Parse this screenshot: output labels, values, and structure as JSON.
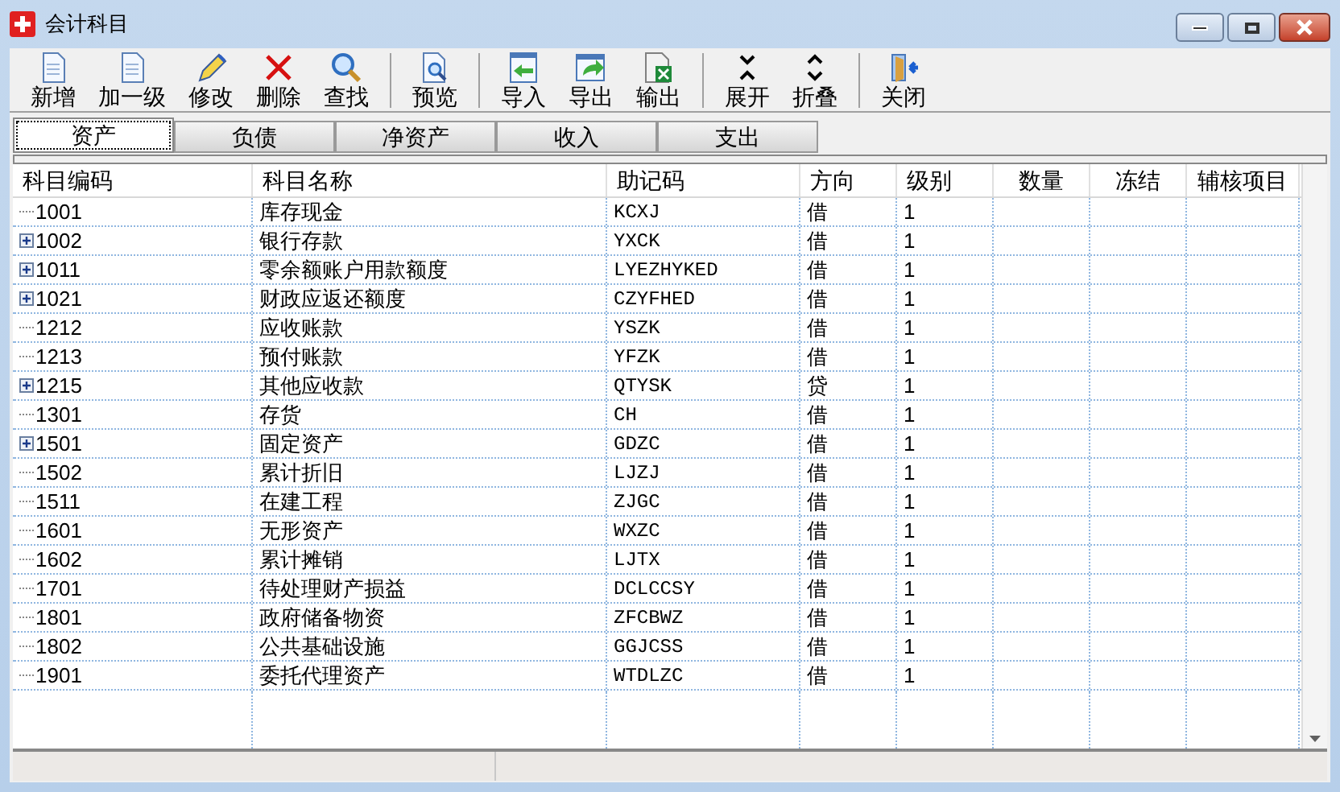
{
  "window": {
    "title": "会计科目"
  },
  "toolbar": [
    {
      "kind": "button",
      "label": "新增"
    },
    {
      "kind": "button",
      "label": "加一级"
    },
    {
      "kind": "button",
      "label": "修改"
    },
    {
      "kind": "button",
      "label": "删除"
    },
    {
      "kind": "button",
      "label": "查找"
    },
    {
      "kind": "separator"
    },
    {
      "kind": "button",
      "label": "预览"
    },
    {
      "kind": "separator"
    },
    {
      "kind": "button",
      "label": "导入"
    },
    {
      "kind": "button",
      "label": "导出"
    },
    {
      "kind": "button",
      "label": "输出"
    },
    {
      "kind": "separator"
    },
    {
      "kind": "button",
      "label": "展开"
    },
    {
      "kind": "button",
      "label": "折叠"
    },
    {
      "kind": "separator"
    },
    {
      "kind": "button",
      "label": "关闭"
    }
  ],
  "tabs": [
    {
      "label": "资产",
      "selected": true
    },
    {
      "label": "负债",
      "selected": false
    },
    {
      "label": "净资产",
      "selected": false
    },
    {
      "label": "收入",
      "selected": false
    },
    {
      "label": "支出",
      "selected": false
    }
  ],
  "table": {
    "columns": [
      "科目编码",
      "科目名称",
      "助记码",
      "方向",
      "级别",
      "数量",
      "冻结",
      "辅核项目"
    ],
    "rows": [
      {
        "expandable": false,
        "cells": [
          "1001",
          "库存现金",
          "KCXJ",
          "借",
          "1"
        ]
      },
      {
        "expandable": true,
        "cells": [
          "1002",
          "银行存款",
          "YXCK",
          "借",
          "1"
        ]
      },
      {
        "expandable": true,
        "cells": [
          "1011",
          "零余额账户用款额度",
          "LYEZHYKED",
          "借",
          "1"
        ]
      },
      {
        "expandable": true,
        "cells": [
          "1021",
          "财政应返还额度",
          "CZYFHED",
          "借",
          "1"
        ]
      },
      {
        "expandable": false,
        "cells": [
          "1212",
          "应收账款",
          "YSZK",
          "借",
          "1"
        ]
      },
      {
        "expandable": false,
        "cells": [
          "1213",
          "预付账款",
          "YFZK",
          "借",
          "1"
        ]
      },
      {
        "expandable": true,
        "cells": [
          "1215",
          "其他应收款",
          "QTYSK",
          "贷",
          "1"
        ]
      },
      {
        "expandable": false,
        "cells": [
          "1301",
          "存货",
          "CH",
          "借",
          "1"
        ]
      },
      {
        "expandable": true,
        "cells": [
          "1501",
          "固定资产",
          "GDZC",
          "借",
          "1"
        ]
      },
      {
        "expandable": false,
        "cells": [
          "1502",
          "累计折旧",
          "LJZJ",
          "借",
          "1"
        ]
      },
      {
        "expandable": false,
        "cells": [
          "1511",
          "在建工程",
          "ZJGC",
          "借",
          "1"
        ]
      },
      {
        "expandable": false,
        "cells": [
          "1601",
          "无形资产",
          "WXZC",
          "借",
          "1"
        ]
      },
      {
        "expandable": false,
        "cells": [
          "1602",
          "累计摊销",
          "LJTX",
          "借",
          "1"
        ]
      },
      {
        "expandable": false,
        "cells": [
          "1701",
          "待处理财产损益",
          "DCLCCSY",
          "借",
          "1"
        ]
      },
      {
        "expandable": false,
        "cells": [
          "1801",
          "政府储备物资",
          "ZFCBWZ",
          "借",
          "1"
        ]
      },
      {
        "expandable": false,
        "cells": [
          "1802",
          "公共基础设施",
          "GGJCSS",
          "借",
          "1"
        ]
      },
      {
        "expandable": false,
        "cells": [
          "1901",
          "委托代理资产",
          "WTDLZC",
          "借",
          "1"
        ]
      }
    ]
  }
}
